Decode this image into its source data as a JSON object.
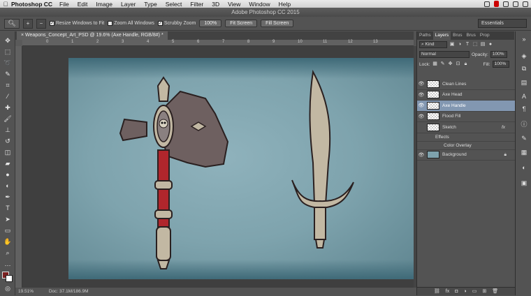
{
  "mac_menu": {
    "apple": "",
    "app_name": "Photoshop CC",
    "items": [
      "File",
      "Edit",
      "Image",
      "Layer",
      "Type",
      "Select",
      "Filter",
      "3D",
      "View",
      "Window",
      "Help"
    ]
  },
  "window_title": "Adobe Photoshop CC 2015",
  "options_bar": {
    "tool_icon": "zoom-icon",
    "zoom_in": "+",
    "zoom_out": "−",
    "resize_windows": "Resize Windows to Fit",
    "zoom_all_windows": "Zoom All Windows",
    "scrubby_zoom": "Scrubby Zoom",
    "btn_100": "100%",
    "btn_fit": "Fit Screen",
    "btn_fill": "Fill Screen",
    "workspace": "Essentials"
  },
  "document_tab": "Weapons_Concept_Art_PSD @ 19.6% (Axe Handle, RGB/8#) *",
  "ruler_ticks": [
    "0",
    "1",
    "2",
    "3",
    "4",
    "5",
    "6",
    "7",
    "8",
    "9",
    "10",
    "11",
    "12",
    "13"
  ],
  "status": {
    "zoom": "19.51%",
    "doc": "Doc: 37.1M/186.9M"
  },
  "panel": {
    "tabs": [
      "Paths",
      "Layers",
      "Brus",
      "Brus",
      "Prop"
    ],
    "active_tab": "Layers",
    "filter": "Kind",
    "blend_mode": "Normal",
    "opacity_label": "Opacity:",
    "opacity_value": "100%",
    "lock_label": "Lock:",
    "fill_label": "Fill:",
    "fill_value": "100%",
    "layers": [
      {
        "name": "Clean Lines",
        "visible": true
      },
      {
        "name": "Axe Head",
        "visible": true
      },
      {
        "name": "Axe Handle",
        "visible": true,
        "selected": true
      },
      {
        "name": "Flood Fill",
        "visible": true
      },
      {
        "name": "Sketch",
        "visible": false,
        "fx": "fx"
      },
      {
        "name": "Effects",
        "visible": true,
        "sub": true
      },
      {
        "name": "Color Overlay",
        "visible": true,
        "sub2": true
      },
      {
        "name": "Background",
        "visible": true,
        "locked": true
      }
    ],
    "footer_icons": [
      "link-icon",
      "fx-icon",
      "mask-icon",
      "adjustment-icon",
      "group-icon",
      "new-layer-icon",
      "trash-icon"
    ]
  },
  "colors": {
    "ui_bg": "#535353",
    "canvas_blue": "#7ea3ad",
    "selected_layer": "#8297b1",
    "axe_handle_red": "#b0262c",
    "weapon_tan": "#c2b8a3"
  }
}
